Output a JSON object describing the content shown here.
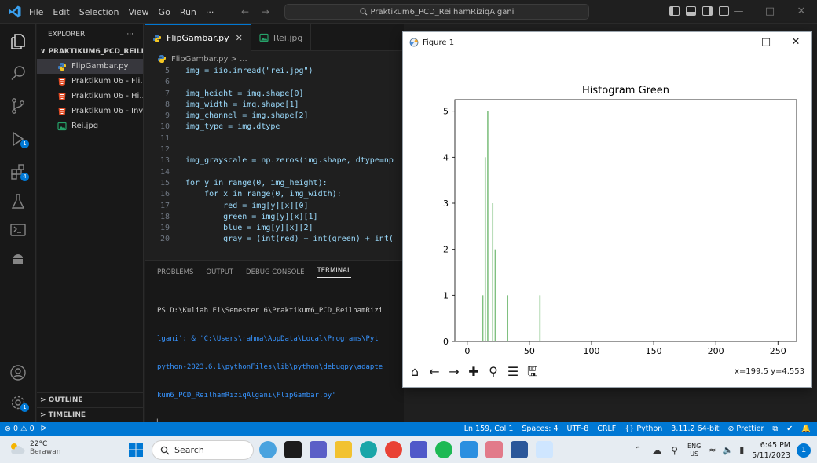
{
  "titlebar": {
    "menu": [
      "File",
      "Edit",
      "Selection",
      "View",
      "Go",
      "Run",
      "···"
    ],
    "nav_arrows": "← →",
    "command_center": "Praktikum6_PCD_ReilhamRiziqAlgani"
  },
  "activity_badges": {
    "run": "1",
    "extensions": "4",
    "accounts": "1"
  },
  "sidebar": {
    "title": "EXPLORER",
    "more": "···",
    "folder": "∨ PRAKTIKUM6_PCD_REILHA...",
    "files": [
      {
        "name": "FlipGambar.py",
        "icon": "python-icon",
        "active": true
      },
      {
        "name": "Praktikum 06 - Fli...",
        "icon": "html-icon"
      },
      {
        "name": "Praktikum 06 - Hi...",
        "icon": "html-icon"
      },
      {
        "name": "Praktikum 06 - Inv...",
        "icon": "html-icon"
      },
      {
        "name": "Rei.jpg",
        "icon": "image-icon"
      }
    ],
    "outline": "> OUTLINE",
    "timeline": "> TIMELINE"
  },
  "editor": {
    "tabs": [
      {
        "label": "FlipGambar.py",
        "active": true
      },
      {
        "label": "Rei.jpg",
        "active": false
      }
    ],
    "breadcrumb": "FlipGambar.py > ...",
    "lines": [
      {
        "n": "5",
        "text": "img = iio.imread(\"rei.jpg\")"
      },
      {
        "n": "6",
        "text": ""
      },
      {
        "n": "7",
        "text": "img_height = img.shape[0]"
      },
      {
        "n": "8",
        "text": "img_width = img.shape[1]"
      },
      {
        "n": "9",
        "text": "img_channel = img.shape[2]"
      },
      {
        "n": "10",
        "text": "img_type = img.dtype"
      },
      {
        "n": "11",
        "text": ""
      },
      {
        "n": "12",
        "text": ""
      },
      {
        "n": "13",
        "text": "img_grayscale = np.zeros(img.shape, dtype=np"
      },
      {
        "n": "14",
        "text": ""
      },
      {
        "n": "15",
        "text": "for y in range(0, img_height):"
      },
      {
        "n": "16",
        "text": "    for x in range(0, img_width):"
      },
      {
        "n": "17",
        "text": "        red = img[y][x][0]"
      },
      {
        "n": "18",
        "text": "        green = img[y][x][1]"
      },
      {
        "n": "19",
        "text": "        blue = img[y][x][2]"
      },
      {
        "n": "20",
        "text": "        gray = (int(red) + int(green) + int("
      }
    ]
  },
  "panel": {
    "tabs": [
      "PROBLEMS",
      "OUTPUT",
      "DEBUG CONSOLE",
      "TERMINAL"
    ],
    "terminal": [
      {
        "text": "PS D:\\Kuliah Ei\\Semester 6\\Praktikum6_PCD_ReilhamRizi",
        "blue": false
      },
      {
        "text": "lgani'; & 'C:\\Users\\rahma\\AppData\\Local\\Programs\\Pyt",
        "blue": true
      },
      {
        "text": "python-2023.6.1\\pythonFiles\\lib\\python\\debugpy\\adapte",
        "blue": true
      },
      {
        "text": "kum6_PCD_ReilhamRiziqAlgani\\FlipGambar.py'",
        "blue": true
      }
    ],
    "cursor": "▏"
  },
  "statusbar": {
    "remote": "⊗ 0 ⚠ 0",
    "left_extra": "ᐅ",
    "position": "Ln 159, Col 1",
    "spaces": "Spaces: 4",
    "encoding": "UTF-8",
    "eol": "CRLF",
    "language": "{} Python",
    "interpreter": "3.11.2 64-bit",
    "prettier": "⊘ Prettier"
  },
  "taskbar": {
    "temp": "22°C",
    "weather": "Berawan",
    "search": "Search",
    "lang_top": "ENG",
    "lang_bottom": "US",
    "time": "6:45 PM",
    "date": "5/11/2023",
    "notif_count": "1"
  },
  "figure": {
    "window_title": "Figure 1",
    "coords": "x=199.5 y=4.553"
  },
  "chart_data": {
    "type": "bar",
    "title": "Histogram Green",
    "xlabel": "",
    "ylabel": "",
    "xlim": [
      -10,
      265
    ],
    "ylim": [
      0,
      5.25
    ],
    "xticks": [
      0,
      50,
      100,
      150,
      200,
      250
    ],
    "yticks": [
      0,
      1,
      2,
      3,
      4,
      5
    ],
    "bar_width": 1,
    "bar_color": "#80c080",
    "bins": [
      {
        "x": 12,
        "y": 1
      },
      {
        "x": 14,
        "y": 4
      },
      {
        "x": 16,
        "y": 5
      },
      {
        "x": 20,
        "y": 3
      },
      {
        "x": 22,
        "y": 2
      },
      {
        "x": 32,
        "y": 1
      },
      {
        "x": 58,
        "y": 1
      }
    ],
    "grid": false
  }
}
